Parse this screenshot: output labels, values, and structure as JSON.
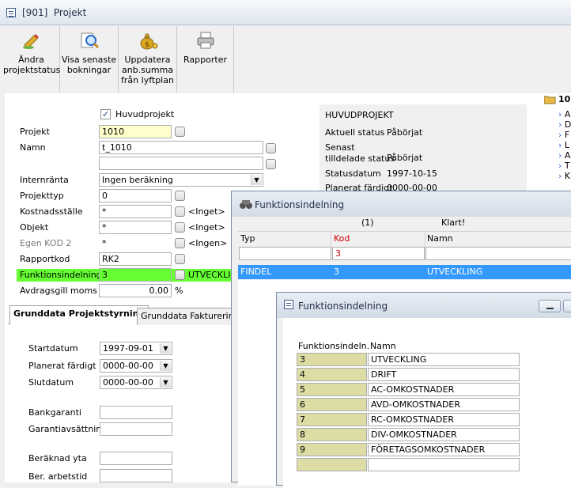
{
  "window": {
    "title": "[901]  Projekt"
  },
  "toolbar": {
    "buttons": [
      {
        "label": "Ändra\nprojektstatus",
        "icon": "edit-icon"
      },
      {
        "label": "Visa senaste\nbokningar",
        "icon": "magnifier-icon"
      },
      {
        "label": "Uppdatera\nanb.summa\nfrån lyftplan",
        "icon": "moneybag-icon"
      },
      {
        "label": "Rapporter",
        "icon": "printer-icon"
      }
    ]
  },
  "form": {
    "huvudprojekt_label": "Huvudprojekt",
    "huvudprojekt_checked": true,
    "projekt_label": "Projekt",
    "projekt_value": "1010",
    "namn_label": "Namn",
    "namn_value": "t_1010",
    "namn2_value": "",
    "internranta_label": "Internränta",
    "internranta_value": "Ingen beräkning",
    "projekttyp_label": "Projekttyp",
    "projekttyp_value": "0",
    "kostnadsstalle_label": "Kostnadsställe",
    "kostnadsstalle_value": "*",
    "kostnadsstalle_note": "<Inget>",
    "objekt_label": "Objekt",
    "objekt_value": "*",
    "objekt_note": "<Inget>",
    "egenkod_label": "Egen KOD 2",
    "egenkod_value": "*",
    "egenkod_note": "<Ingen>",
    "rapportkod_label": "Rapportkod",
    "rapportkod_value": "RK2",
    "funktion_label": "Funktionsindelning",
    "funktion_value": "3",
    "funktion_note": "UTVECKLI",
    "avdrag_label": "Avdragsgill moms",
    "avdrag_value": "0.00",
    "avdrag_unit": "%"
  },
  "tabs": [
    {
      "label": "Grunddata Projektstyrning",
      "active": true
    },
    {
      "label": "Grunddata Fakturering",
      "active": false
    }
  ],
  "tabpanel": {
    "startdatum_label": "Startdatum",
    "startdatum_value": "1997-09-01",
    "planerat_label": "Planerat färdigt",
    "planerat_value": "0000-00-00",
    "slutdatum_label": "Slutdatum",
    "slutdatum_value": "0000-00-00",
    "bankgaranti_label": "Bankgaranti",
    "garanti_label": "Garantiavsättning",
    "yta_label": "Beräknad yta",
    "arbetstid_label": "Ber. arbetstid"
  },
  "info": {
    "heading": "HUVUDPROJEKT",
    "rows": [
      {
        "label": "Aktuell status",
        "value": "Påbörjat"
      },
      {
        "label": "Senast\ntilldelade status",
        "value": "Påbörjat"
      },
      {
        "label": "Statusdatum",
        "value": "1997-10-15"
      },
      {
        "label": "Planerat färdigt",
        "value": "0000-00-00"
      }
    ]
  },
  "tree": {
    "root": "10",
    "items": [
      "A",
      "D",
      "F",
      "L",
      "A",
      "T",
      "K"
    ]
  },
  "lookup": {
    "title": "Funktionsindelning",
    "count": "(1)",
    "status": "Klart!",
    "col_typ": "Typ",
    "col_kod": "Kod",
    "col_namn": "Namn",
    "filter_kod": "3",
    "row": {
      "typ": "FINDEL",
      "kod": "3",
      "namn": "UTVECKLING"
    }
  },
  "dialog": {
    "title": "Funktionsindelning",
    "col_kod": "Funktionsindeln.",
    "col_namn": "Namn",
    "rows": [
      {
        "kod": "3",
        "namn": "UTVECKLING"
      },
      {
        "kod": "4",
        "namn": "DRIFT"
      },
      {
        "kod": "5",
        "namn": "AC-OMKOSTNADER"
      },
      {
        "kod": "6",
        "namn": "AVD-OMKOSTNADER"
      },
      {
        "kod": "7",
        "namn": "RC-OMKOSTNADER"
      },
      {
        "kod": "8",
        "namn": "DIV-OMKOSTNADER"
      },
      {
        "kod": "9",
        "namn": "FÖRETAGSOMKOSTNADER"
      },
      {
        "kod": "",
        "namn": ""
      }
    ]
  },
  "colors": {
    "highlight_green": "#66ff33",
    "yellow_field": "#ffffcc",
    "selection_blue": "#3399ff",
    "code_cell": "#dcdca4",
    "kod_red": "#cc0000"
  }
}
